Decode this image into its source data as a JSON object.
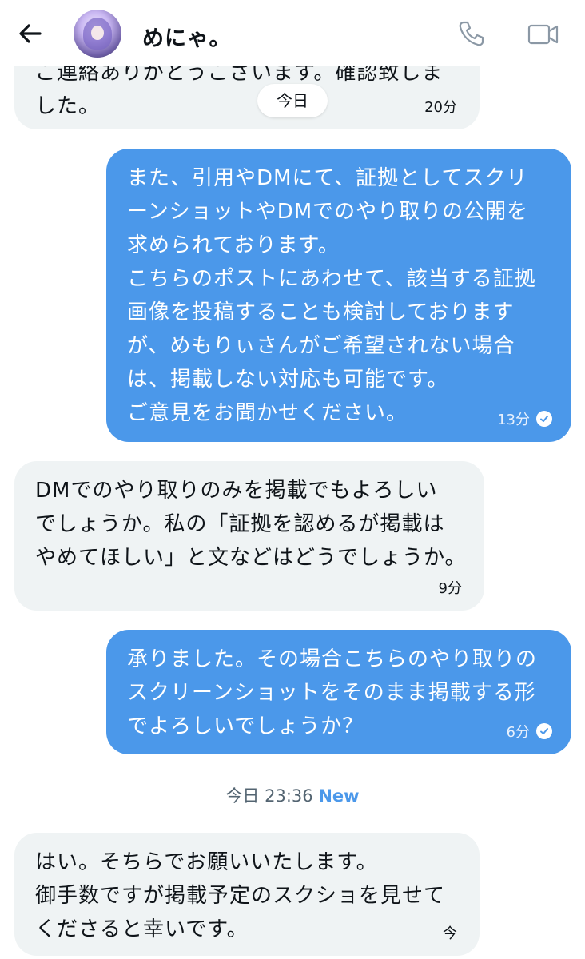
{
  "header": {
    "contact_name": "めにゃ。",
    "icons": [
      "back-arrow-icon",
      "phone-icon",
      "video-icon"
    ]
  },
  "date_pill": "今日",
  "messages": [
    {
      "side": "incoming",
      "text": "ご連絡ありがとうございます。確認致しま\nした。",
      "time": "20分"
    },
    {
      "side": "outgoing",
      "text": "また、引用やDMにて、証拠としてスクリ\nーンショットやDMでのやり取りの公開を\n求められております。\nこちらのポストにあわせて、該当する証拠\n画像を投稿することも検討しております\nが、めもりぃさんがご希望されない場合\nは、掲載しない対応も可能です。\nご意見をお聞かせください。",
      "time": "13分",
      "read": true
    },
    {
      "side": "incoming",
      "text": "DMでのやり取りのみを掲載でもよろしい\nでしょうか。私の「証拠を認めるが掲載は\nやめてほしい」と文などはどうでしょうか。",
      "time": "9分"
    },
    {
      "side": "outgoing",
      "text": "承りました。その場合こちらのやり取りの\nスクリーンショットをそのまま掲載する形\nでよろしいでしょうか？",
      "time": "6分",
      "read": true
    },
    {
      "side": "incoming",
      "text": "はい。そちらでお願いいたします。\n御手数ですが掲載予定のスクショを見せて\nくださると幸いです。",
      "time": "今"
    }
  ],
  "divider": {
    "date": "今日 23:36",
    "badge": "New"
  },
  "colors": {
    "outgoing_bubble": "#4b98ea",
    "incoming_bubble": "#eff3f4",
    "accent": "#4b98ea"
  }
}
